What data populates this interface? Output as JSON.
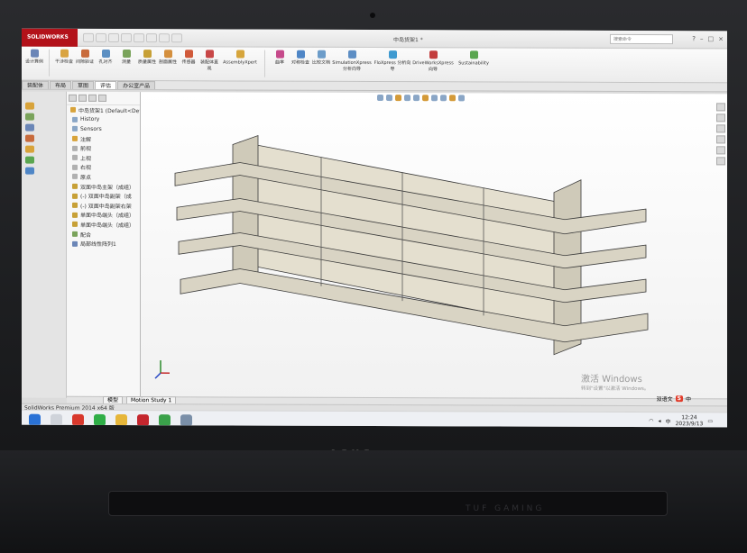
{
  "app": {
    "brand": "SOLIDWORKS",
    "doc_title": "中岛货架1 *",
    "search_placeholder": "搜索命令",
    "status": "SolidWorks Premium 2014 x64 版"
  },
  "ribbon": [
    {
      "label": "设计算例"
    },
    {
      "label": "干涉检查"
    },
    {
      "label": "间隙验证"
    },
    {
      "label": "孔对齐"
    },
    {
      "label": "测量"
    },
    {
      "label": "质量属性"
    },
    {
      "label": "剖面属性"
    },
    {
      "label": "传感器"
    },
    {
      "label": "装配体直观"
    },
    {
      "label": "AssemblyXpert"
    },
    {
      "label": "曲率"
    },
    {
      "label": "对称检查"
    },
    {
      "label": "比较文档"
    },
    {
      "label": "SimulationXpress 分析向导"
    },
    {
      "label": "FloXpress 分析向导"
    },
    {
      "label": "DriveWorksXpress 向导"
    },
    {
      "label": "Sustainability"
    }
  ],
  "tabs": [
    "装配体",
    "布局",
    "草图",
    "评估",
    "办公室产品"
  ],
  "tree": {
    "root": "中岛货架1 (Default<Def",
    "items": [
      "History",
      "Sensors",
      "注解",
      "前视",
      "上视",
      "右视",
      "原点",
      "双面中岛主架（成组）",
      "(-) 双面中岛副架（成",
      "(-) 双面中岛副架右架",
      "单面中岛端头（成组）",
      "单面中岛端头（成组）",
      "配合",
      "局部线性阵列1"
    ]
  },
  "bottom_tabs": [
    "模型",
    "Motion Study 1"
  ],
  "watermark": {
    "line1": "激活 Windows",
    "line2": "转到\"设置\"以激活 Windows。"
  },
  "ime": {
    "label": "中",
    "extra": "双语文"
  },
  "clock": {
    "time": "12:24",
    "date": "2023/9/13"
  },
  "laptop": {
    "brand": "ASUS",
    "series": "TUF GAMING"
  },
  "colors": {
    "brand_red": "#b3121a",
    "shelf_fill": "#d9d4c4",
    "shelf_edge": "#3a3a3a"
  }
}
